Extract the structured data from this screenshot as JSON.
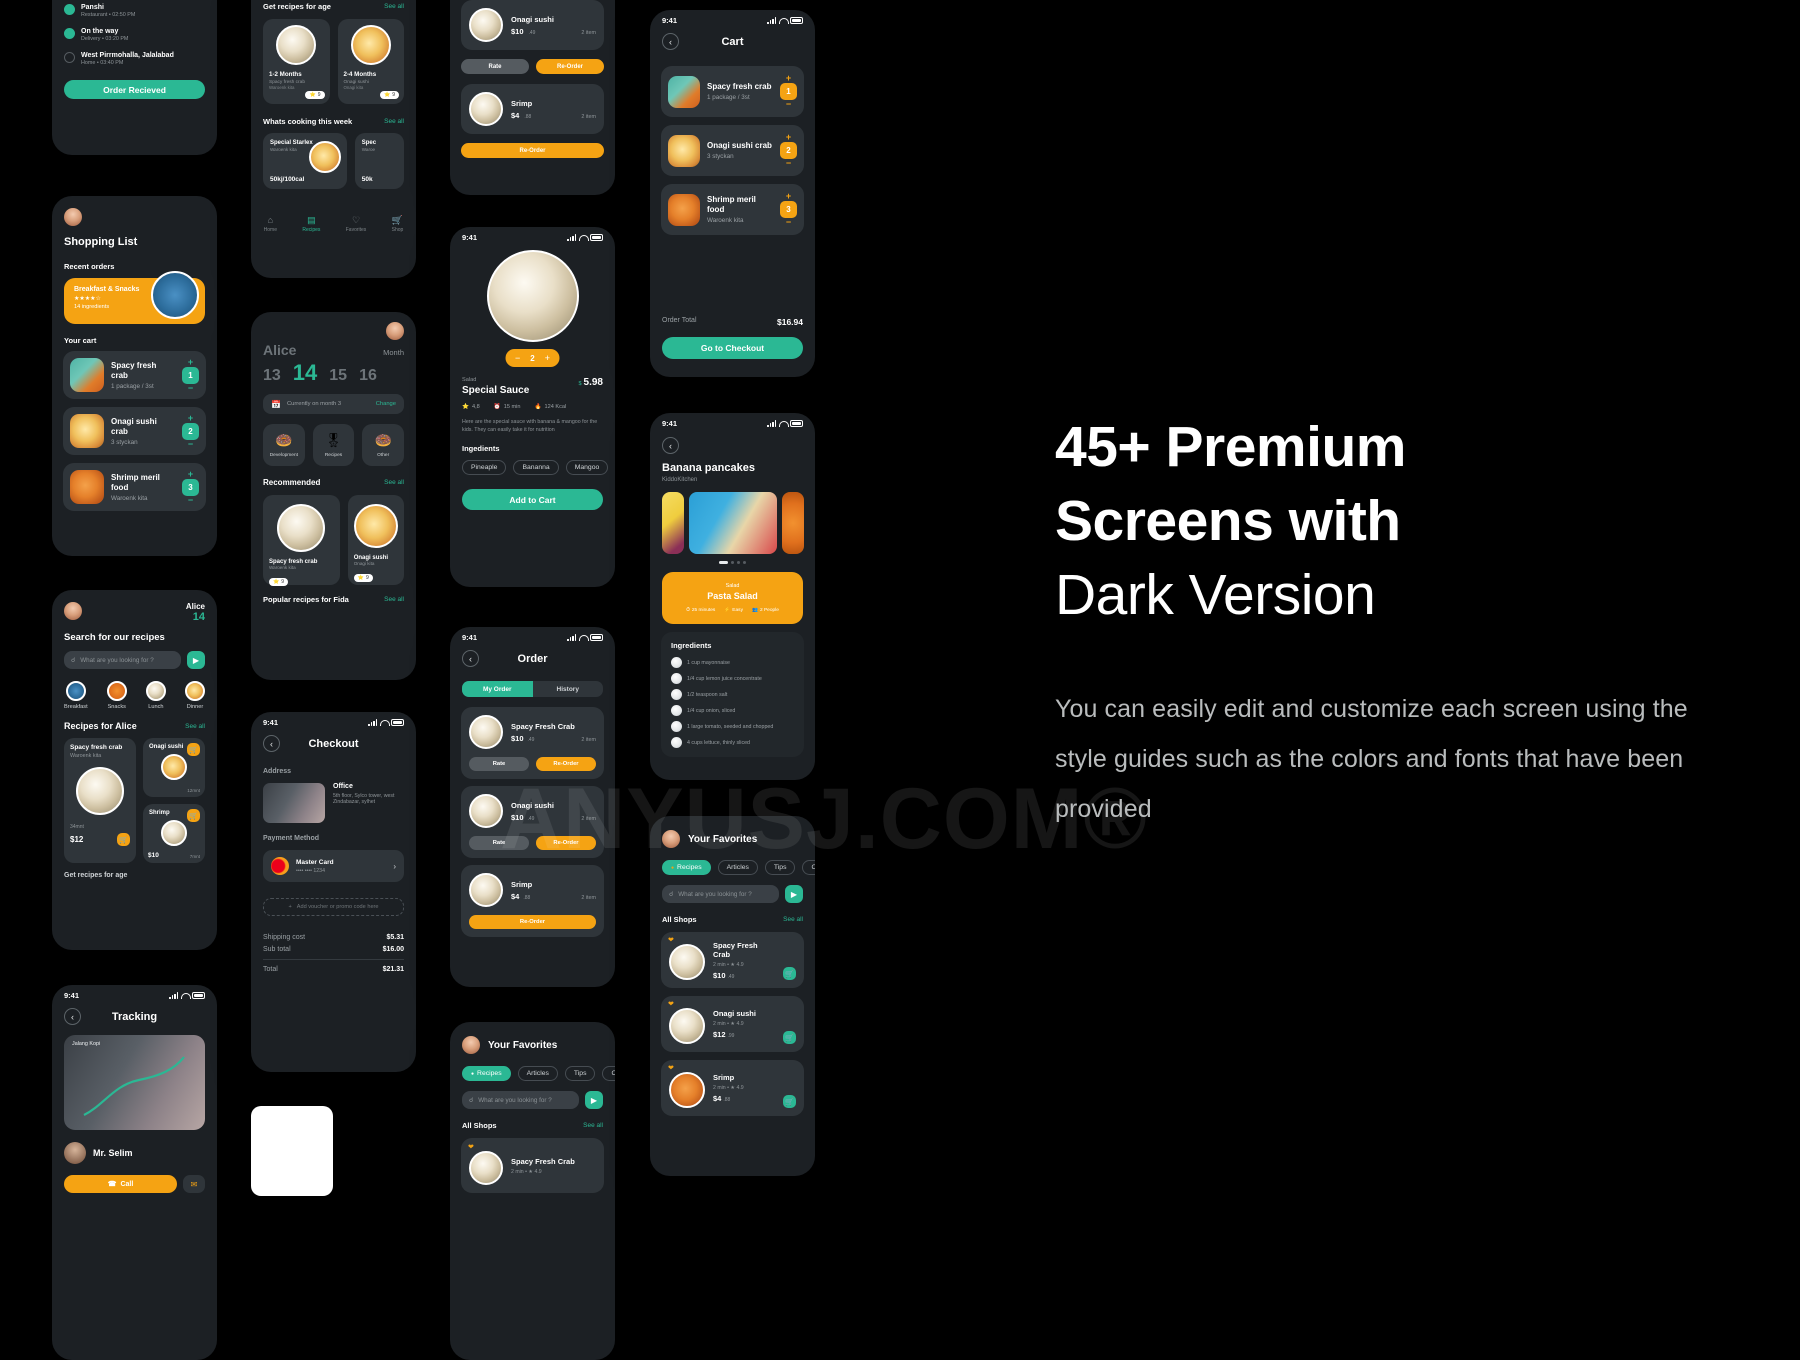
{
  "promo": {
    "headline_line1": "45+ Premium",
    "headline_line2": "Screens with",
    "headline_line3": "Dark Version",
    "body": "You can easily edit and customize each screen using the style guides such as the colors and fonts that have been provided"
  },
  "watermark": {
    "text": "ANYUSJ.COM®"
  },
  "colors": {
    "accent_green": "#2bb894",
    "accent_orange": "#f5a313",
    "background": "#000000",
    "card": "#2f353a",
    "screen": "#1c2024"
  },
  "status_bar": {
    "time": "9:41"
  },
  "screens": {
    "tracking_top": {
      "steps": [
        {
          "title": "Panshi",
          "sub": "Restaurant • 02:50 PM"
        },
        {
          "title": "On the way",
          "sub": "Delivery • 03:20 PM"
        },
        {
          "title": "West Pirrmohalla, Jalalabad",
          "sub": "Home • 03:40 PM"
        }
      ],
      "button": "Order Recieved"
    },
    "shopping_list": {
      "title": "Shopping List",
      "recent_label": "Recent orders",
      "recent_card": {
        "title": "Breakfast & Snacks",
        "stars": "★★★★☆",
        "sub": "14 ingredients"
      },
      "cart_label": "Your cart",
      "items": [
        {
          "title": "Spacy fresh crab",
          "sub": "1 package / 3st",
          "qty": "1"
        },
        {
          "title": "Onagi sushi crab",
          "sub": "3 styckan",
          "qty": "2"
        },
        {
          "title": "Shrimp meril food",
          "sub": "Waroenk kita",
          "qty": "3"
        }
      ]
    },
    "search_recipes": {
      "user_name": "Alice",
      "user_count": "14",
      "title": "Search for our recipes",
      "search_placeholder": "What are you looking for ?",
      "categories": [
        "Breakfast",
        "Snacks",
        "Lunch",
        "Dinner"
      ],
      "section": "Recipes for Alice",
      "see_all": "See all",
      "cards": [
        {
          "title": "Spacy fresh crab",
          "sub": "Waroenk kita",
          "price": "$12",
          "cents": ".00",
          "meta": "34mnt"
        },
        {
          "title": "Onagi sushi",
          "sub": "",
          "price": "",
          "cents": "",
          "meta": "12mnt"
        },
        {
          "title": "Shrimp",
          "sub": "",
          "price": "$10",
          "cents": ".40",
          "meta": "7mnt"
        }
      ],
      "footer_section": "Get recipes for age"
    },
    "tracking": {
      "title": "Tracking",
      "map_label": "Jalang Kopi",
      "driver_name": "Mr. Selim",
      "call_button": "Call"
    },
    "recipes_age": {
      "title": "Get recipes for age",
      "see_all": "See all",
      "ages": [
        {
          "label": "1-2 Months",
          "sub": "Spacy fresh crab",
          "sub2": "Waroenk kita"
        },
        {
          "label": "2-4 Months",
          "sub": "Onagi sushi",
          "sub2": "Onagi kita"
        }
      ],
      "week_title": "Whats cooking this week",
      "week_cards": [
        {
          "title": "Special Starlex",
          "sub": "Waroenk kita",
          "value": "50kj/100cal"
        },
        {
          "title": "Spec",
          "sub": "Waroe",
          "value": "50k"
        }
      ],
      "tabs": [
        "Home",
        "Recipes",
        "Favorites",
        "Shop"
      ]
    },
    "calendar": {
      "name": "Alice",
      "month_label": "Month",
      "days": [
        "13",
        "14",
        "15",
        "16"
      ],
      "active_day": "14",
      "month_banner": "Currently on month 3",
      "change": "Change",
      "categories": [
        "Development",
        "Recipes",
        "Other"
      ],
      "recommended_label": "Recommended",
      "see_all": "See all",
      "recommended": [
        {
          "title": "Spacy fresh crab",
          "sub": "Waroenk kita",
          "rating": "9"
        },
        {
          "title": "Onagi sushi",
          "sub": "Onagi kita",
          "rating": "9"
        }
      ],
      "popular_label": "Popular recipes for Fida",
      "popular_see_all": "See all"
    },
    "checkout": {
      "title": "Checkout",
      "address_label": "Address",
      "address_title": "Office",
      "address_line1": "5th floor, Sylco tower, west",
      "address_line2": "Zindabazar, sylhet",
      "payment_label": "Payment Method",
      "card_name": "Master Card",
      "card_number": "•••• •••• 1234",
      "voucher": "Add voucher or promo code here",
      "totals": [
        {
          "label": "Shipping cost",
          "value": "$5.31"
        },
        {
          "label": "Sub total",
          "value": "$16.00"
        }
      ],
      "total_label": "Total",
      "total_value": "$21.31"
    },
    "reorder_top": {
      "items": [
        {
          "title": "Onagi sushi",
          "price": "$10",
          "cents": ".49",
          "meta": "2 item"
        },
        {
          "title": "Srimp",
          "price": "$4",
          "cents": ".88",
          "meta": "2 item"
        }
      ],
      "rate": "Rate",
      "reorder": "Re-Order"
    },
    "recipe_detail": {
      "qty": "2",
      "category": "Salad",
      "title": "Special Sauce",
      "price_symbol": "$",
      "price": "5.98",
      "rating": "4,8",
      "time": "15 min",
      "kcal": "124 Kcal",
      "description": "Here are the special sauce with banana & mangoo for the kids. They can easily take it for nutrition",
      "ingredients_label": "Ingedients",
      "ingredients": [
        "Pineaple",
        "Bananna",
        "Mangoo"
      ],
      "button": "Add to Cart"
    },
    "order": {
      "title": "Order",
      "tabs": [
        "My Order",
        "History"
      ],
      "active_tab": "My Order",
      "items": [
        {
          "title": "Spacy Fresh Crab",
          "price": "$10",
          "cents": ".49",
          "meta": "2 item"
        },
        {
          "title": "Onagi sushi",
          "price": "$10",
          "cents": ".49",
          "meta": "2 item"
        },
        {
          "title": "Srimp",
          "price": "$4",
          "cents": ".88",
          "meta": "2 item"
        }
      ],
      "rate": "Rate",
      "reorder": "Re-Order"
    },
    "favorites_bottom": {
      "title": "Your Favorites",
      "chips": [
        "Recipes",
        "Articles",
        "Tips",
        "Offer"
      ],
      "active_chip": "Recipes",
      "search_placeholder": "What are you looking for ?",
      "section": "All Shops",
      "see_all": "See all",
      "items": [
        {
          "title": "Spacy Fresh Crab",
          "meta": "2 min • ★ 4.9"
        }
      ]
    },
    "cart": {
      "title": "Cart",
      "items": [
        {
          "title": "Spacy fresh crab",
          "sub": "1 package / 3st",
          "qty": "1"
        },
        {
          "title": "Onagi sushi crab",
          "sub": "3 styckan",
          "qty": "2"
        },
        {
          "title": "Shrimp meril food",
          "sub": "Waroenk kita",
          "qty": "3"
        }
      ],
      "total_label": "Order Total",
      "total_value": "$16.94",
      "checkout_button": "Go to Checkout"
    },
    "pancakes": {
      "title": "Banana pancakes",
      "author": "KiddoKitchen",
      "banner_category": "Salad",
      "banner_title": "Pasta Salad",
      "banner_time": "25 minutes",
      "banner_level": "Easy",
      "banner_people": "2 People",
      "ingredients_label": "Ingredients",
      "ingredients": [
        "1 cup mayonnaise",
        "1/4 cup lemon juice concentrate",
        "1/2 teaspoon salt",
        "1/4 cup onion, sliced",
        "1 large tomato, seeded and chopped",
        "4 cups lettuce, thinly sliced"
      ]
    },
    "favorites_shops": {
      "title": "Your Favorites",
      "chips": [
        "Recipes",
        "Articles",
        "Tips",
        "Offer"
      ],
      "active_chip": "Recipes",
      "search_placeholder": "What are you looking for ?",
      "section": "All Shops",
      "see_all": "See all",
      "items": [
        {
          "title": "Spacy Fresh Crab",
          "meta": "2 min • ★ 4.9",
          "price": "$10",
          "cents": ".49"
        },
        {
          "title": "Onagi sushi",
          "meta": "2 min • ★ 4.9",
          "price": "$12",
          "cents": ".99"
        },
        {
          "title": "Srimp",
          "meta": "2 min • ★ 4.9",
          "price": "$4",
          "cents": ".88"
        }
      ]
    }
  }
}
